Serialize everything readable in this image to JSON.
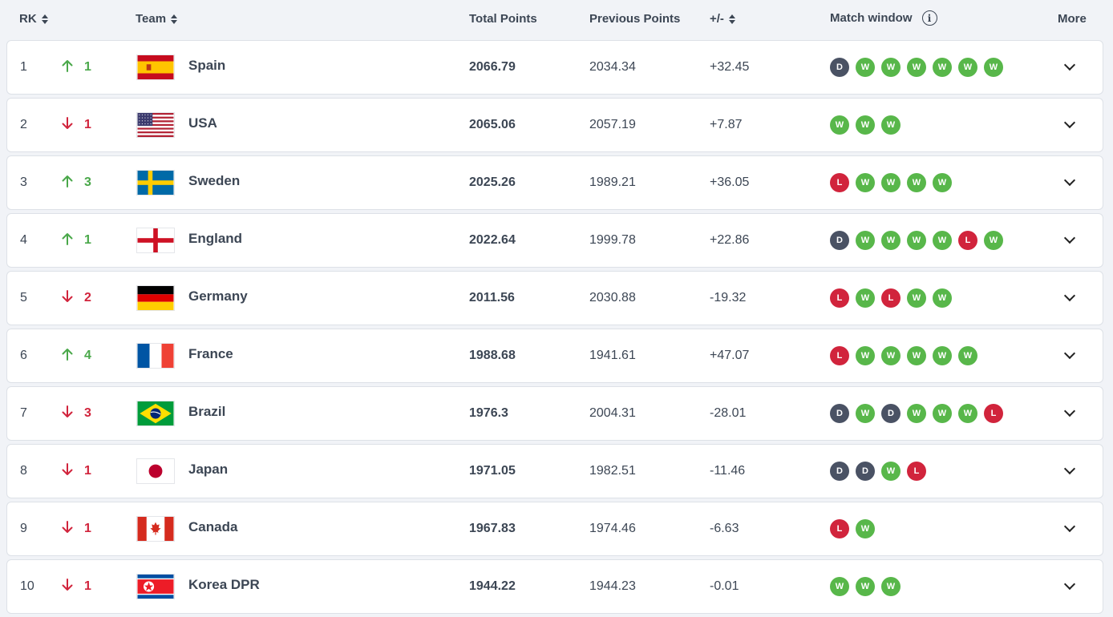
{
  "header": {
    "rk": "RK",
    "team": "Team",
    "total": "Total Points",
    "prev": "Previous Points",
    "diff": "+/-",
    "window": "Match window",
    "more": "More"
  },
  "colors": {
    "up": "#4aa84a",
    "down": "#d1243c",
    "win": "#58b74a",
    "loss": "#d1243c",
    "draw": "#4a5264"
  },
  "rows": [
    {
      "rk": "1",
      "dir": "up",
      "move": "1",
      "flag": "spain",
      "team": "Spain",
      "total": "2066.79",
      "prev": "2034.34",
      "diff": "+32.45",
      "window": [
        "D",
        "W",
        "W",
        "W",
        "W",
        "W",
        "W"
      ]
    },
    {
      "rk": "2",
      "dir": "down",
      "move": "1",
      "flag": "usa",
      "team": "USA",
      "total": "2065.06",
      "prev": "2057.19",
      "diff": "+7.87",
      "window": [
        "W",
        "W",
        "W"
      ]
    },
    {
      "rk": "3",
      "dir": "up",
      "move": "3",
      "flag": "sweden",
      "team": "Sweden",
      "total": "2025.26",
      "prev": "1989.21",
      "diff": "+36.05",
      "window": [
        "L",
        "W",
        "W",
        "W",
        "W"
      ]
    },
    {
      "rk": "4",
      "dir": "up",
      "move": "1",
      "flag": "england",
      "team": "England",
      "total": "2022.64",
      "prev": "1999.78",
      "diff": "+22.86",
      "window": [
        "D",
        "W",
        "W",
        "W",
        "W",
        "L",
        "W"
      ]
    },
    {
      "rk": "5",
      "dir": "down",
      "move": "2",
      "flag": "germany",
      "team": "Germany",
      "total": "2011.56",
      "prev": "2030.88",
      "diff": "-19.32",
      "window": [
        "L",
        "W",
        "L",
        "W",
        "W"
      ]
    },
    {
      "rk": "6",
      "dir": "up",
      "move": "4",
      "flag": "france",
      "team": "France",
      "total": "1988.68",
      "prev": "1941.61",
      "diff": "+47.07",
      "window": [
        "L",
        "W",
        "W",
        "W",
        "W",
        "W"
      ]
    },
    {
      "rk": "7",
      "dir": "down",
      "move": "3",
      "flag": "brazil",
      "team": "Brazil",
      "total": "1976.3",
      "prev": "2004.31",
      "diff": "-28.01",
      "window": [
        "D",
        "W",
        "D",
        "W",
        "W",
        "W",
        "L"
      ]
    },
    {
      "rk": "8",
      "dir": "down",
      "move": "1",
      "flag": "japan",
      "team": "Japan",
      "total": "1971.05",
      "prev": "1982.51",
      "diff": "-11.46",
      "window": [
        "D",
        "D",
        "W",
        "L"
      ]
    },
    {
      "rk": "9",
      "dir": "down",
      "move": "1",
      "flag": "canada",
      "team": "Canada",
      "total": "1967.83",
      "prev": "1974.46",
      "diff": "-6.63",
      "window": [
        "L",
        "W"
      ]
    },
    {
      "rk": "10",
      "dir": "down",
      "move": "1",
      "flag": "korea-dpr",
      "team": "Korea DPR",
      "total": "1944.22",
      "prev": "1944.23",
      "diff": "-0.01",
      "window": [
        "W",
        "W",
        "W"
      ]
    }
  ]
}
